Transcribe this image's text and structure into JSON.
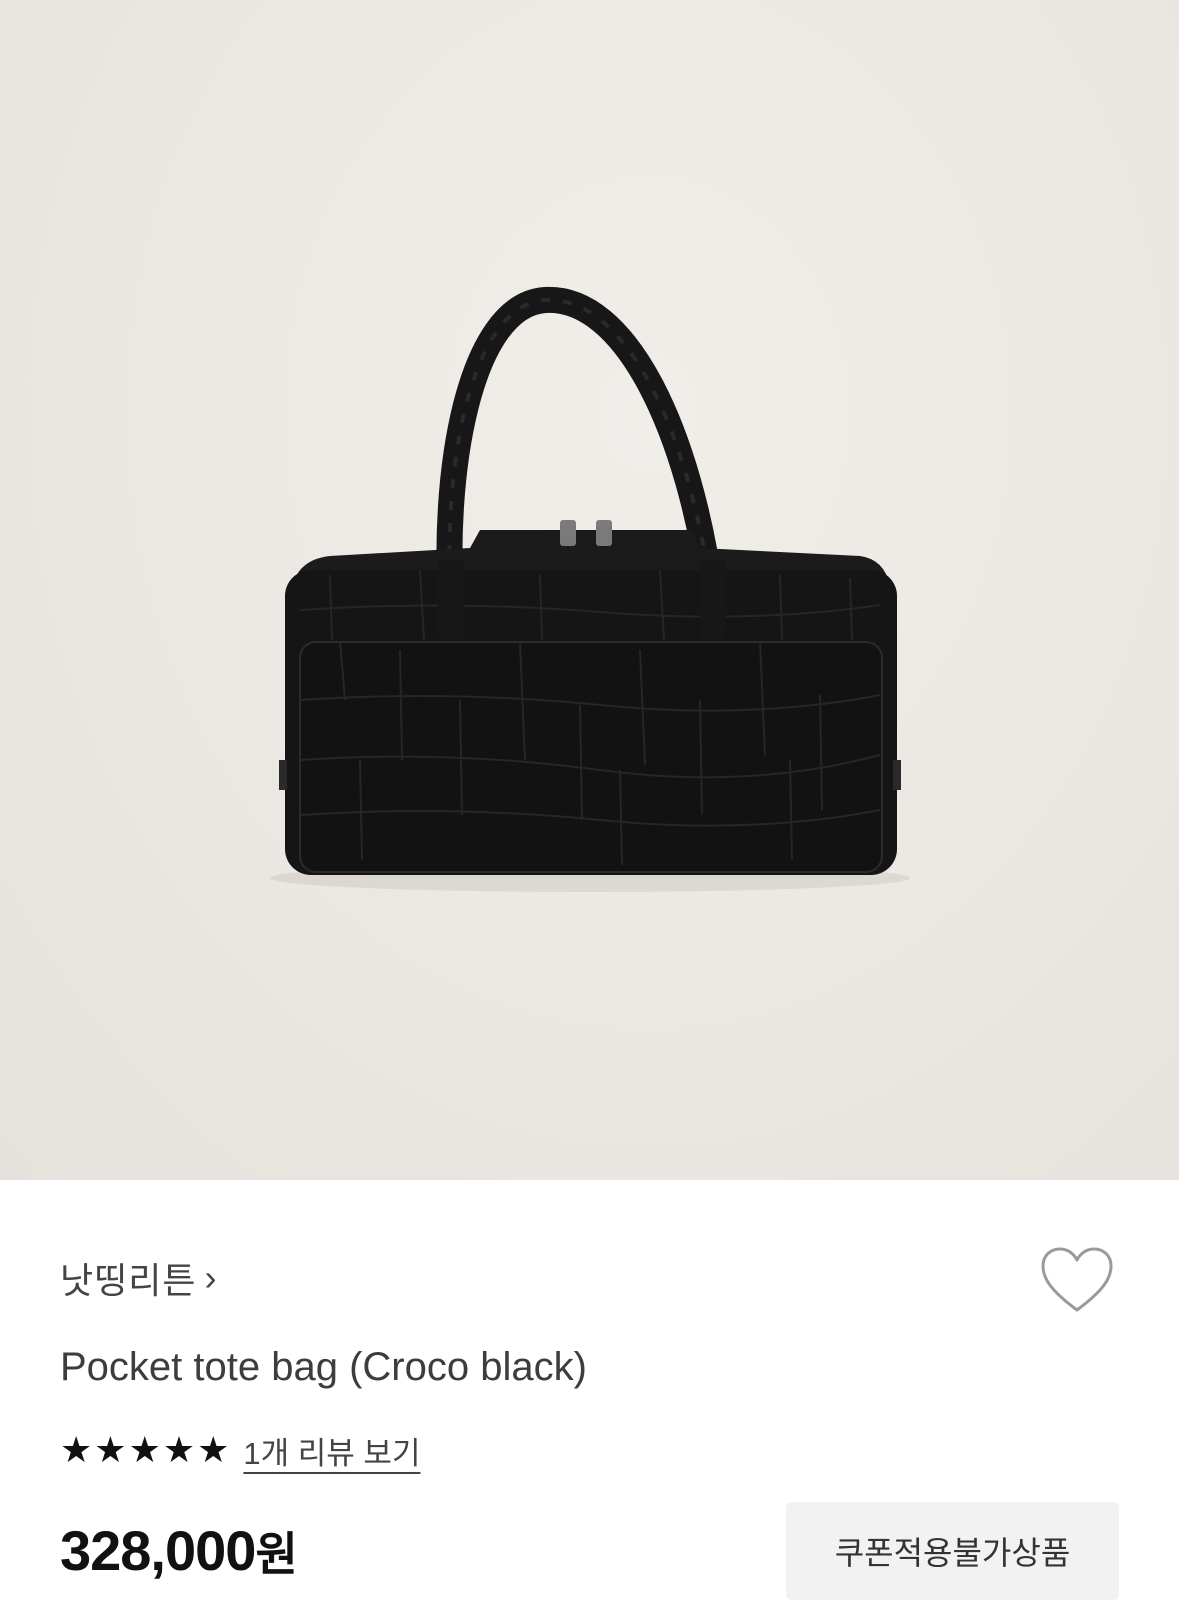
{
  "product": {
    "brand": "낫띵리튼",
    "brand_chevron": "›",
    "title": "Pocket tote bag (Croco black)",
    "rating_stars": 5,
    "star_glyph": "★",
    "review_link": "1개 리뷰 보기",
    "price_value": "328,000",
    "price_unit": "원",
    "coupon_notice": "쿠폰적용불가상품"
  },
  "icons": {
    "wishlist": "heart-outline-icon",
    "chevron": "chevron-right-icon",
    "star": "star-filled-icon"
  },
  "colors": {
    "hero_background": "#ebe7e2",
    "bag": "#141414",
    "coupon_background": "#f2f2f2"
  }
}
